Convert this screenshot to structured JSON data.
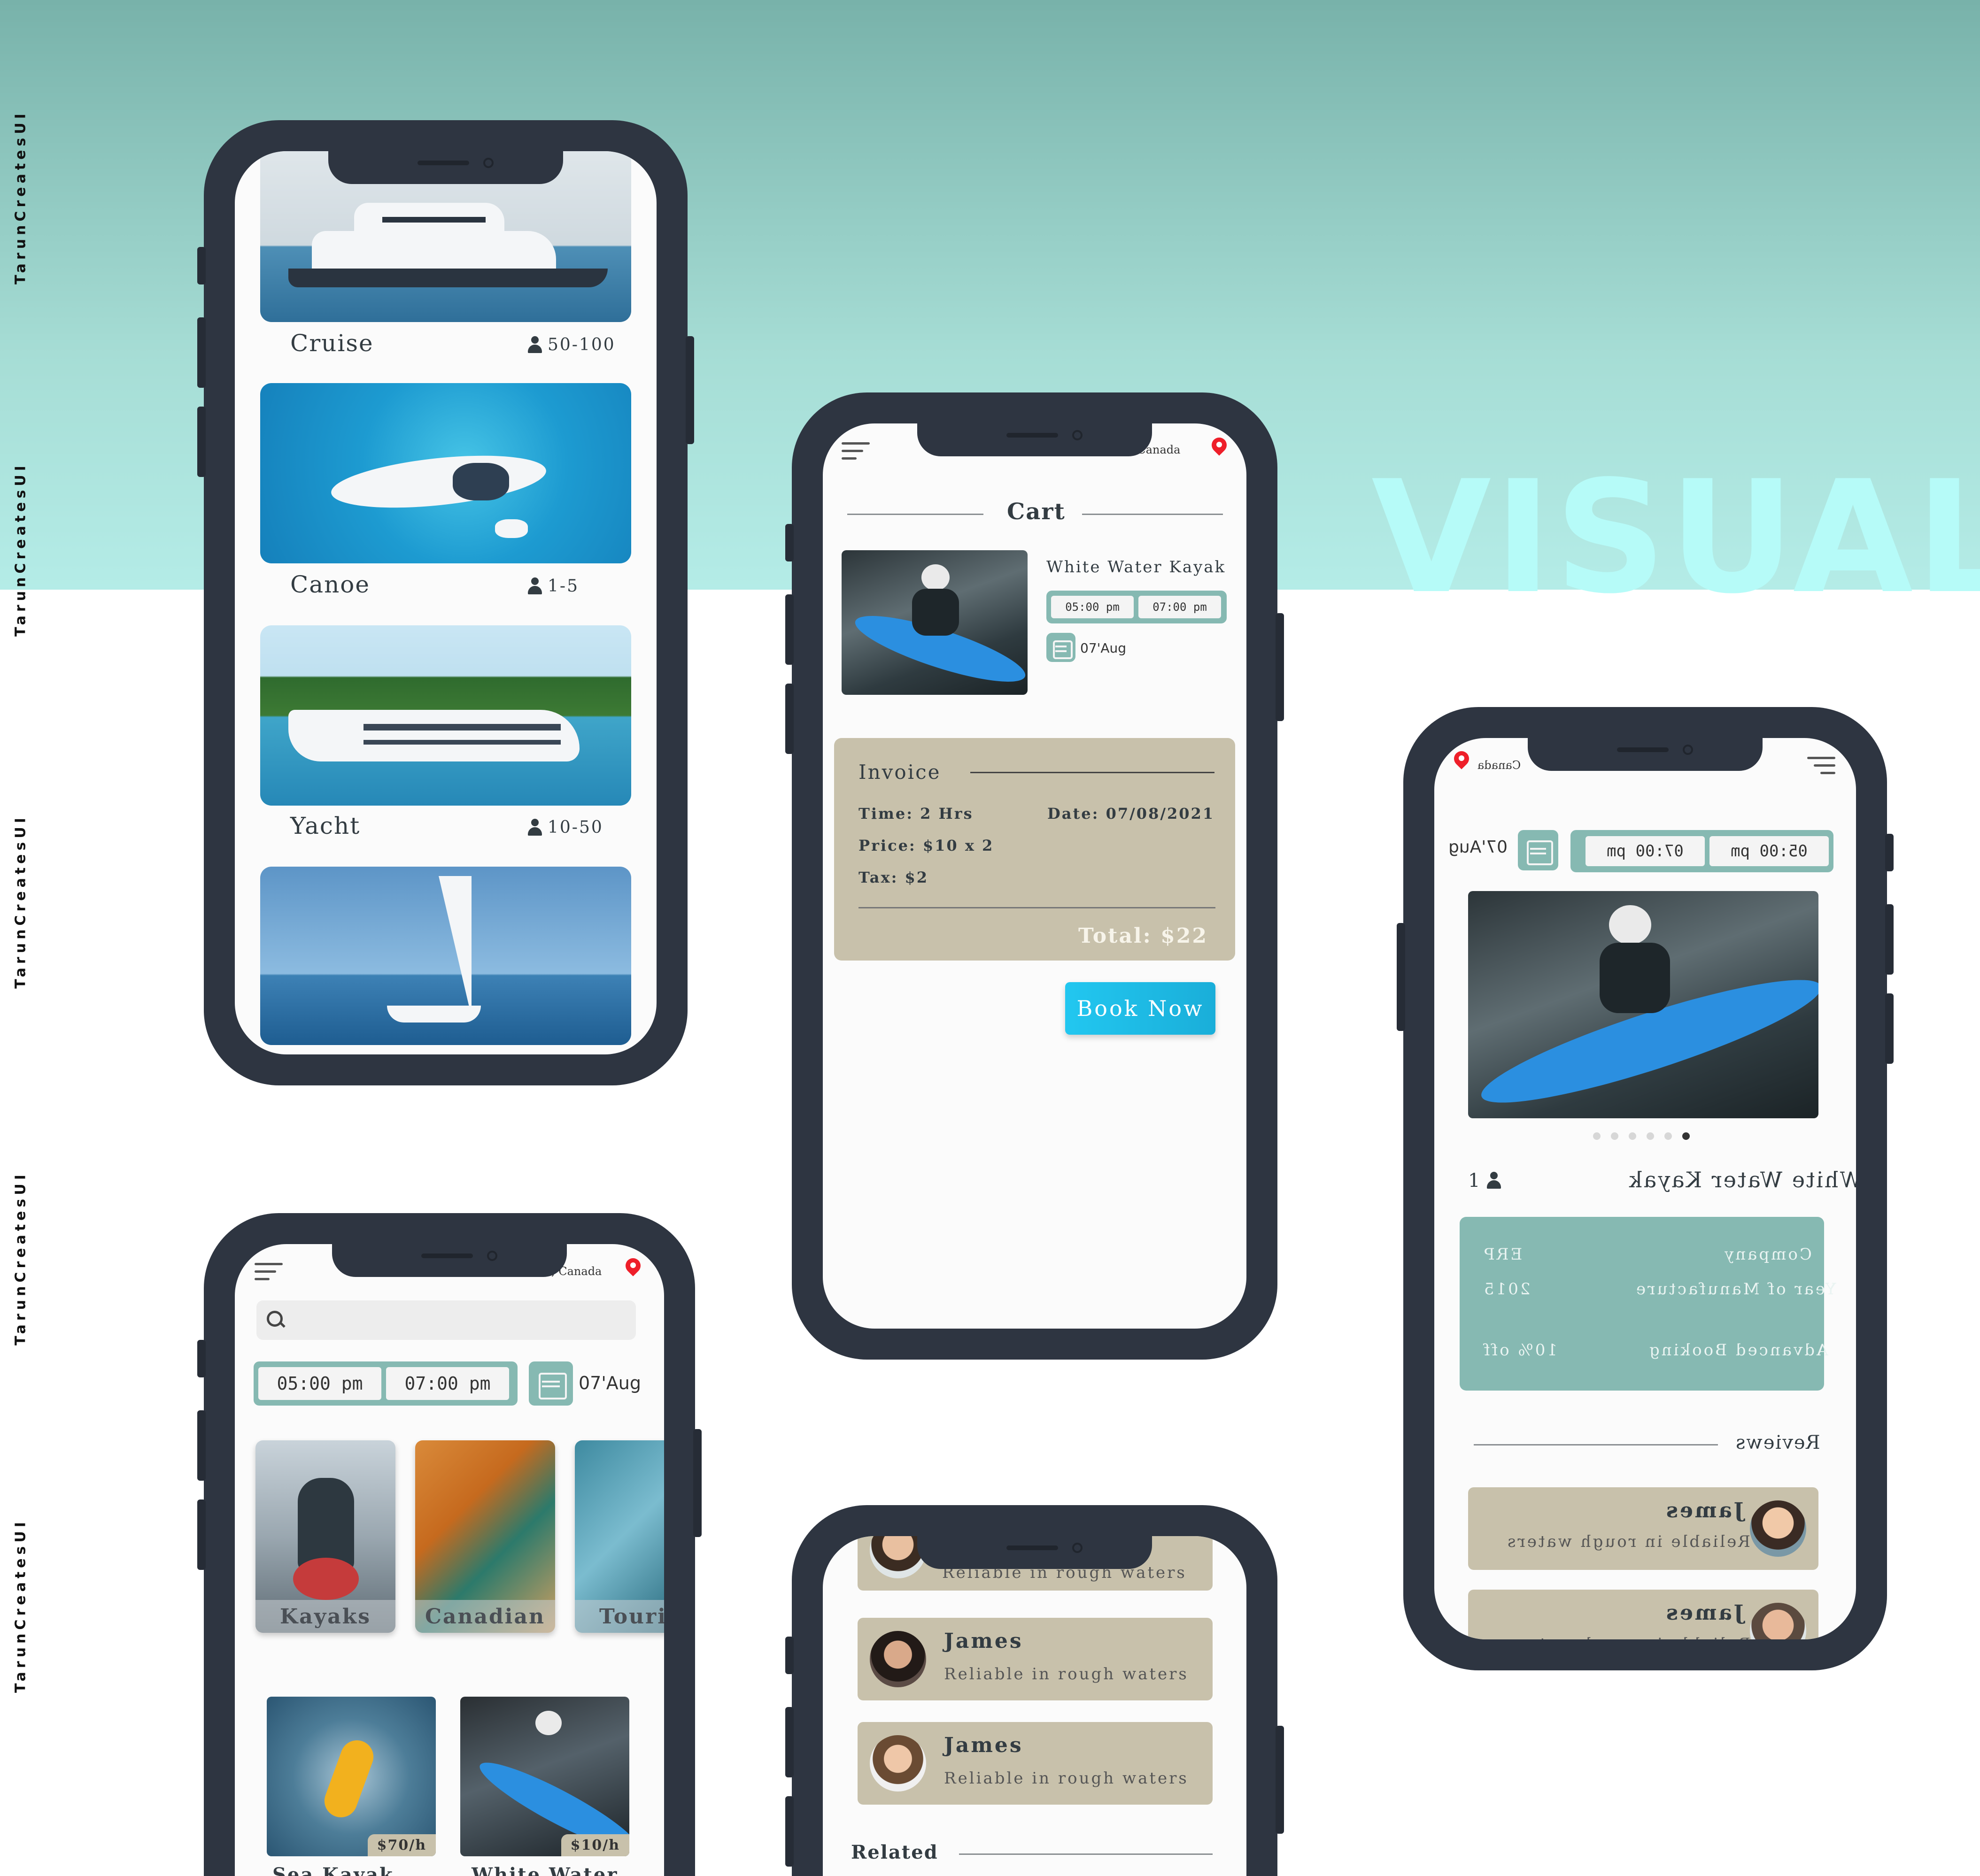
{
  "brand": {
    "watermark": "TarunCreatesUI",
    "headline": "VISUAL"
  },
  "colors": {
    "teal_top": "#78b2aa",
    "teal_light": "#b4ece7",
    "phone_frame": "#2e3541",
    "accent_teal": "#86b9b2",
    "sand": "#c8c1ab",
    "cta": "#22c7f0",
    "pin": "#ee1f2a"
  },
  "listing": {
    "items": [
      {
        "title": "Cruise",
        "capacity": "50-100",
        "icon": "person-icon"
      },
      {
        "title": "Canoe",
        "capacity": "1-5",
        "icon": "person-icon"
      },
      {
        "title": "Yacht",
        "capacity": "10-50",
        "icon": "person-icon"
      }
    ]
  },
  "cart": {
    "location": "Toronto, Canada",
    "title": "Cart",
    "item": {
      "name": "White Water Kayak",
      "start": "05:00 pm",
      "end": "07:00 pm",
      "date": "07'Aug"
    },
    "invoice": {
      "title": "Invoice",
      "time": "Time:  2 Hrs",
      "date": "Date: 07/08/2021",
      "price": "Price: $10 x 2",
      "tax": "Tax: $2",
      "total": "Total: $22"
    },
    "book_label": "Book Now"
  },
  "detail": {
    "location": "Canada",
    "start": "05:00 pm",
    "end": "07:00 pm",
    "date": "07'Aug",
    "title": "White Water Kayak",
    "count": "1",
    "specs": [
      {
        "label": "Company",
        "value": "ERP"
      },
      {
        "label": "Year of Manufacture",
        "value": "2015"
      },
      {
        "label": "Advanced Booking",
        "value": "10% off"
      }
    ],
    "reviews_title": "Reviews",
    "reviews": [
      {
        "name": "James",
        "text": "Reliable in rough waters"
      },
      {
        "name": "James",
        "text": "Reliable in rough waters"
      }
    ],
    "carousel_index": 5,
    "carousel_total": 6
  },
  "browse": {
    "location": ", Canada",
    "search_placeholder": "",
    "start": "05:00 pm",
    "end": "07:00 pm",
    "date": "07'Aug",
    "categories": [
      {
        "label": "Kayaks"
      },
      {
        "label": "Canadian"
      },
      {
        "label": "Touring"
      }
    ],
    "products": [
      {
        "price": "$70/h",
        "name": "Sea Kayak"
      },
      {
        "price": "$10/h",
        "name": "White Water"
      }
    ]
  },
  "reviews_screen": {
    "partial_text": "Reliable in rough waters",
    "reviews": [
      {
        "name": "James",
        "text": "Reliable in rough waters"
      },
      {
        "name": "James",
        "text": "Reliable in rough waters"
      }
    ],
    "related_title": "Related"
  }
}
